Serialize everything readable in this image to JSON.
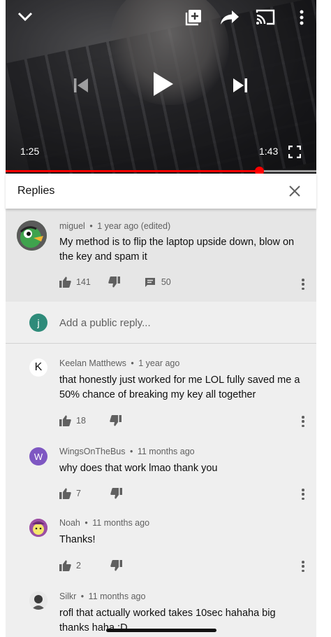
{
  "player": {
    "current_time": "1:25",
    "duration": "1:43",
    "progress": 0.815,
    "icons": [
      "chevron-down-icon",
      "add-to-playlist-icon",
      "share-icon",
      "cast-icon",
      "more-vert-icon",
      "skip-previous-icon",
      "play-icon",
      "skip-next-icon",
      "fullscreen-icon"
    ]
  },
  "replies_header": {
    "title": "Replies"
  },
  "original_comment": {
    "author": "miguel",
    "age": "1 year ago (edited)",
    "text": "My method is to flip the laptop upside down, blow on the key and spam it",
    "likes": "141",
    "replies": "50"
  },
  "add_reply": {
    "avatar_letter": "j",
    "placeholder": "Add a public reply..."
  },
  "replies": [
    {
      "author": "Keelan Matthews",
      "age": "1 year ago",
      "text": "that honestly just worked for me LOL fully saved me a 50% chance of breaking my key all together",
      "likes": "18",
      "avatar_letter": "K"
    },
    {
      "author": "WingsOnTheBus",
      "age": "11 months ago",
      "text": "why does that work lmao thank you",
      "likes": "7",
      "avatar_letter": "W"
    },
    {
      "author": "Noah",
      "age": "11 months ago",
      "text": "Thanks!",
      "likes": "2",
      "avatar_letter": ""
    },
    {
      "author": "Silkr",
      "age": "11 months ago",
      "text": "rofl that actually worked takes 10sec hahaha big thanks haha :D",
      "likes": "",
      "avatar_letter": ""
    }
  ],
  "separator": "•",
  "colors": {
    "progress": "#ff0000",
    "reply_avatar_j": "#2e8b7a",
    "avatar_w": "#7e57c2"
  }
}
